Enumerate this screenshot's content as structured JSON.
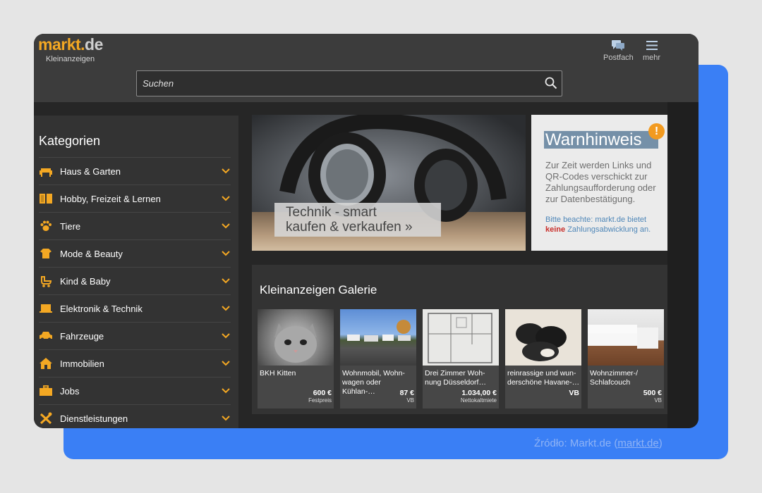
{
  "brand": {
    "logo_main": "markt",
    "logo_dot": ".",
    "logo_tld": "de",
    "tagline": "Kleinanzeigen"
  },
  "header": {
    "inbox_label": "Postfach",
    "more_label": "mehr",
    "search_placeholder": "Suchen"
  },
  "sidebar": {
    "title": "Kategorien",
    "items": [
      {
        "label": "Haus & Garten",
        "icon": "sofa-icon"
      },
      {
        "label": "Hobby, Freizeit & Lernen",
        "icon": "book-icon"
      },
      {
        "label": "Tiere",
        "icon": "paw-icon"
      },
      {
        "label": "Mode & Beauty",
        "icon": "shirt-icon"
      },
      {
        "label": "Kind & Baby",
        "icon": "stroller-icon"
      },
      {
        "label": "Elektronik & Technik",
        "icon": "laptop-icon"
      },
      {
        "label": "Fahrzeuge",
        "icon": "car-icon"
      },
      {
        "label": "Immobilien",
        "icon": "house-icon"
      },
      {
        "label": "Jobs",
        "icon": "briefcase-icon"
      },
      {
        "label": "Dienstleistungen",
        "icon": "tools-icon"
      }
    ]
  },
  "hero": {
    "line1": "Technik - smart",
    "line2": "kaufen & verkaufen »"
  },
  "warning": {
    "title": "Warnhinweis",
    "badge": "!",
    "text": "Zur Zeit werden Links und QR-Codes verschickt zur Zahlungsaufforderung oder zur Datenbestätigung.",
    "note_pre": "Bitte beachte: markt.de bietet",
    "note_red": "keine",
    "note_post": "Zahlungsabwicklung an."
  },
  "gallery": {
    "title": "Kleinanzeigen Galerie",
    "items": [
      {
        "title": "BKH Kitten",
        "price": "600 €",
        "price_type": "Festpreis"
      },
      {
        "title": "Wohnmobil, Wohn-wagen oder Kühlan-…",
        "price": "87 €",
        "price_type": "VB"
      },
      {
        "title": "Drei Zimmer Woh-nung Düsseldorf…",
        "price": "1.034,00 €",
        "price_type": "Nettokaltmiete"
      },
      {
        "title": "reinrassige und wun-derschöne Havane-…",
        "price": "VB",
        "price_type": ""
      },
      {
        "title": "Wohnzimmer-/ Schlafcouch",
        "price": "500 €",
        "price_type": "VB"
      }
    ]
  },
  "source": {
    "prefix": "Źródło: Markt.de (",
    "link": "markt.de",
    "suffix": ")"
  },
  "colors": {
    "accent": "#f4a823",
    "background": "#262626",
    "blue_panel": "#3a7ff5",
    "warning_red": "#c9302c"
  }
}
